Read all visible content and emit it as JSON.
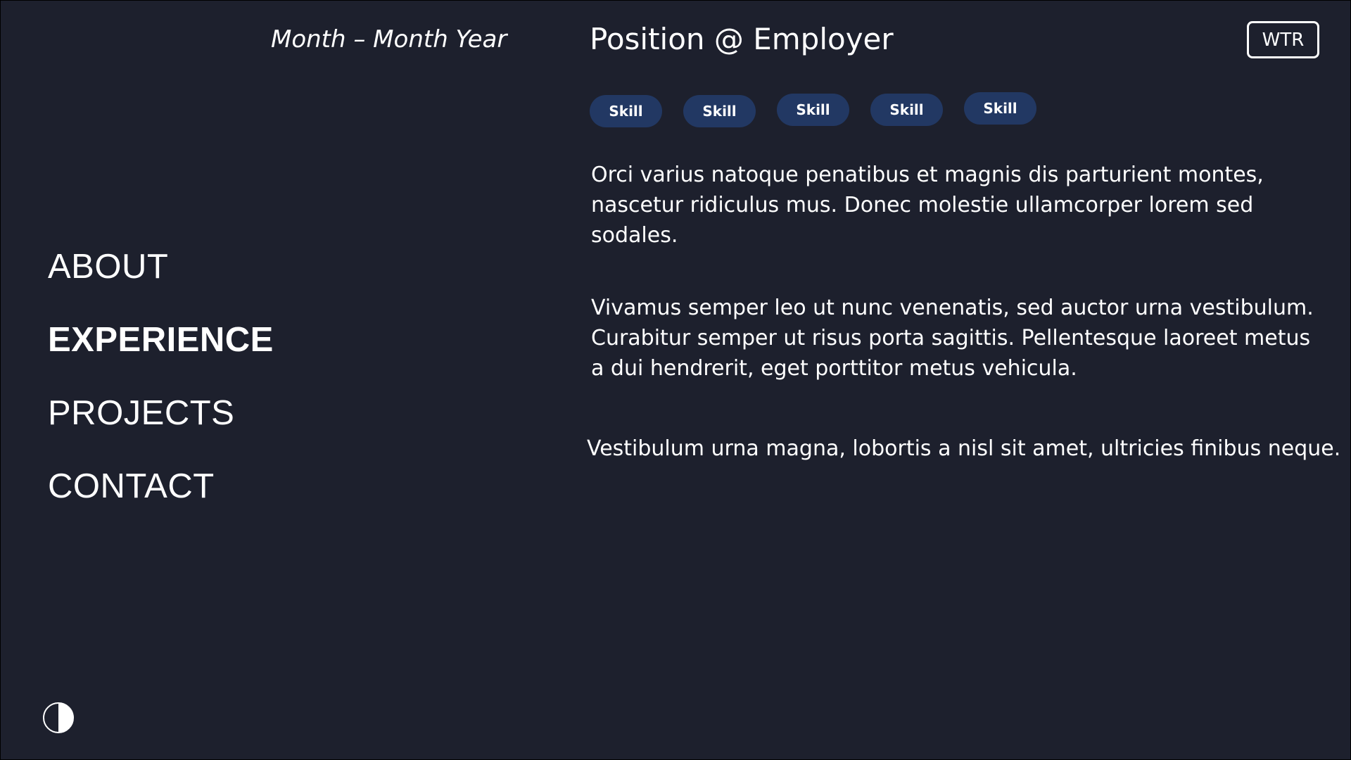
{
  "sidebar": {
    "date_range": "Month – Month Year",
    "nav_items": [
      {
        "label": "ABOUT",
        "active": false
      },
      {
        "label": "EXPERIENCE",
        "active": true
      },
      {
        "label": "PROJECTS",
        "active": false
      },
      {
        "label": "CONTACT",
        "active": false
      }
    ],
    "theme_toggle_icon": "half-circle-contrast-icon"
  },
  "main": {
    "position_title": "Position @ Employer",
    "wtr_button_label": "WTR",
    "skills": [
      "Skill",
      "Skill",
      "Skill",
      "Skill",
      "Skill"
    ],
    "paragraphs": [
      "Orci varius natoque penatibus et magnis dis parturient montes, nascetur ridiculus mus. Donec molestie ullamcorper lorem sed sodales.",
      "Vivamus semper leo ut nunc venenatis, sed auctor urna vestibulum. Curabitur semper ut risus porta sagittis. Pellentesque laoreet metus a dui hendrerit, eget porttitor metus vehicula.",
      "Vestibulum urna magna, lobortis a nisl sit amet, ultricies finibus neque."
    ]
  },
  "colors": {
    "background": "#1d202d",
    "text": "#ffffff",
    "skill_pill": "#223863"
  }
}
